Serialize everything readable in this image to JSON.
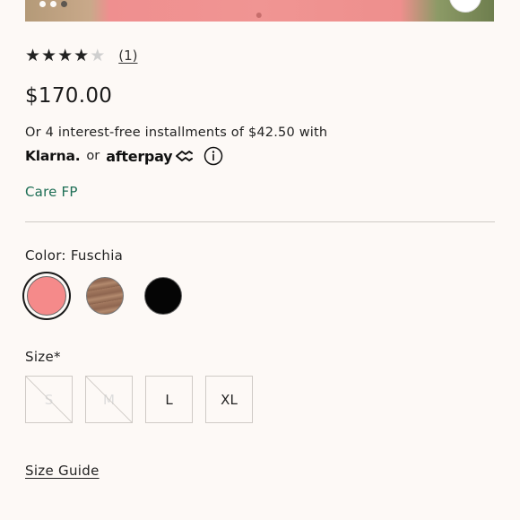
{
  "product": {
    "rating": {
      "value": 4,
      "max": 5,
      "review_count_label": "(1)"
    },
    "price": "$170.00",
    "installments": {
      "text": "Or 4 interest-free installments of $42.50 with",
      "klarna_label": "Klarna.",
      "or_label": "or",
      "afterpay_label": "afterpay"
    },
    "care_link": "Care FP",
    "color": {
      "label": "Color: Fuschia",
      "swatches": [
        {
          "name": "Fuschia",
          "color": "#f58a8a",
          "selected": true
        },
        {
          "name": "Brown",
          "color": "#9a6e56",
          "selected": false
        },
        {
          "name": "Black",
          "color": "#050505",
          "selected": false
        }
      ]
    },
    "size": {
      "label": "Size*",
      "options": [
        {
          "label": "S",
          "available": false
        },
        {
          "label": "M",
          "available": false
        },
        {
          "label": "L",
          "available": true
        },
        {
          "label": "XL",
          "available": true
        }
      ]
    },
    "size_guide_label": "Size Guide"
  },
  "colors": {
    "accent_link": "#1d6e55",
    "text": "#222222",
    "background": "#fdf9f6"
  }
}
